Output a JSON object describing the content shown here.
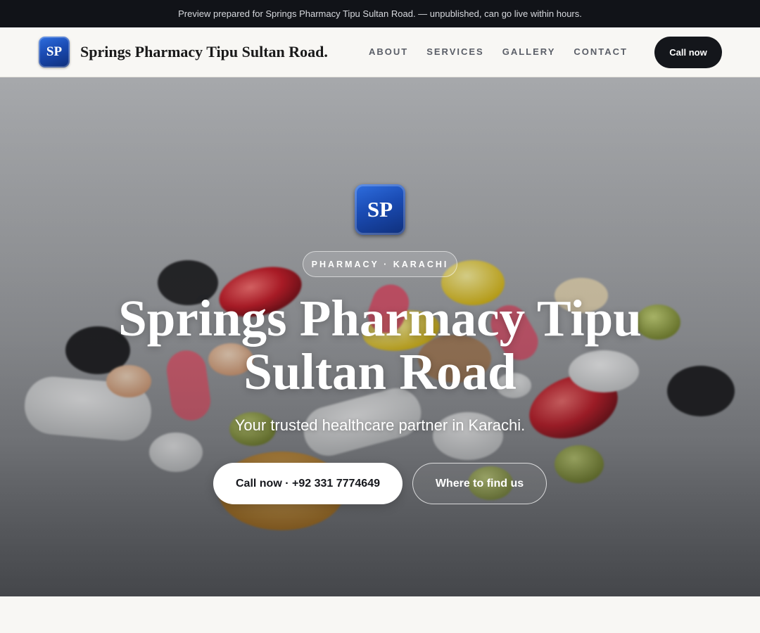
{
  "preview_banner": "Preview prepared for Springs Pharmacy Tipu Sultan Road. — unpublished, can go live within hours.",
  "nav": {
    "logo_initials": "SP",
    "brand": "Springs Pharmacy Tipu Sultan Road.",
    "links": [
      "ABOUT",
      "SERVICES",
      "GALLERY",
      "CONTACT"
    ],
    "cta": "Call now"
  },
  "hero": {
    "badge_initials": "SP",
    "category_pill": "PHARMACY · KARACHI",
    "title": "Springs Pharmacy Tipu Sultan Road",
    "subtitle": "Your trusted healthcare partner in Karachi.",
    "primary_button": "Call now · +92 331 7774649",
    "secondary_button": "Where to find us",
    "background_image": "assorted pills and capsules on a table"
  },
  "colors": {
    "banner_bg": "#111318",
    "nav_bg": "#f8f7f4",
    "cta_bg": "#14161b",
    "badge_blue": "#1a4bb3"
  }
}
